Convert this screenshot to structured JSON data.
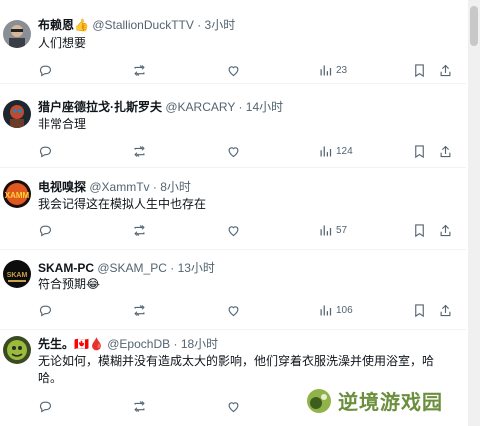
{
  "replies": [
    {
      "name": "布赖恩",
      "badge": "👍",
      "handle": "@StallionDuckTTV",
      "sep": "·",
      "time": "3小时",
      "text": "人们想要",
      "views": "23"
    },
    {
      "name": "猎户座德拉戈·扎斯罗夫",
      "badge": "",
      "handle": "@KARCARY",
      "sep": "·",
      "time": "14小时",
      "text": "非常合理",
      "views": "124"
    },
    {
      "name": "电视嗅探",
      "badge": "",
      "handle": "@XammTv",
      "sep": "·",
      "time": "8小时",
      "text": "我会记得这在模拟人生中也存在",
      "views": "57"
    },
    {
      "name": "SKAM-PC",
      "badge": "",
      "handle": "@SKAM_PC",
      "sep": "·",
      "time": "13小时",
      "text": "符合预期😂",
      "views": "106"
    },
    {
      "name": "先生。",
      "badge": "🇨🇦🩸",
      "handle": "@EpochDB",
      "sep": "·",
      "time": "18小时",
      "text": "无论如何，模糊并没有造成太大的影响，他们穿着衣服洗澡并使用浴室，哈哈。",
      "views": ""
    }
  ],
  "icons": {
    "reply": "reply-icon",
    "repost": "repost-icon",
    "like": "heart-icon",
    "views": "views-chart-icon",
    "bookmark": "bookmark-icon",
    "share": "share-icon"
  },
  "colors": {
    "text": "#0f1419",
    "muted": "#536471",
    "divider": "#eff3f4",
    "watermark": "#6b8f3e"
  },
  "watermark": {
    "text": "逆境游戏园"
  }
}
